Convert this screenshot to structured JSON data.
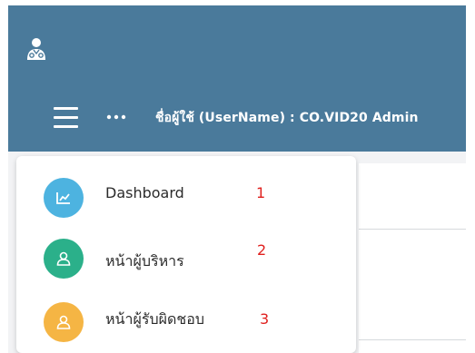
{
  "header": {
    "username_text": "ชื่อผู้ใช้ (UserName) : CO.VID20 Admin",
    "bar_color": "#4a7a9b",
    "logo_icon": "user-doctor-icon",
    "menu_icon": "hamburger-icon",
    "more_icon": "more-dots-icon"
  },
  "menu": {
    "items": [
      {
        "label": "Dashboard",
        "number": "1",
        "icon": "chart-line-icon",
        "color": "#4db3e0"
      },
      {
        "label": "หน้าผู้บริหาร",
        "number": "2",
        "icon": "user-icon",
        "color": "#2bb08a"
      },
      {
        "label": "หน้าผู้รับผิดชอบ",
        "number": "3",
        "icon": "user-icon",
        "color": "#f5b544"
      }
    ]
  }
}
